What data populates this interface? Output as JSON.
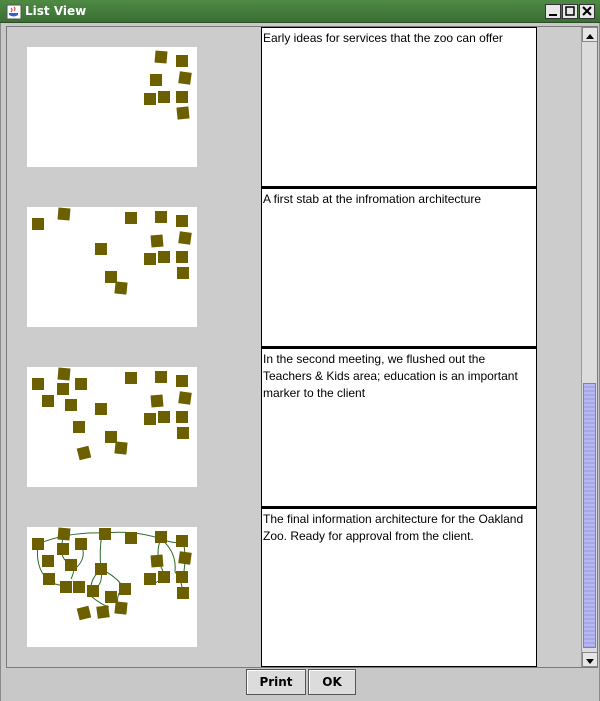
{
  "window": {
    "title": "List View"
  },
  "colors": {
    "note": "#6b5f00",
    "connector": "#2f6b2f",
    "titlebar": "#3e7236"
  },
  "rows": [
    {
      "caption": "Early ideas for services that the zoo can offer"
    },
    {
      "caption": "A first stab at the infromation architecture"
    },
    {
      "caption": "In the second meeting, we flushed out the Teachers & Kids area; education is an important marker to the client"
    },
    {
      "caption": "The final information architecture for the Oakland Zoo. Ready for approval from the client."
    }
  ],
  "buttons": {
    "print": "Print",
    "ok": "OK"
  }
}
